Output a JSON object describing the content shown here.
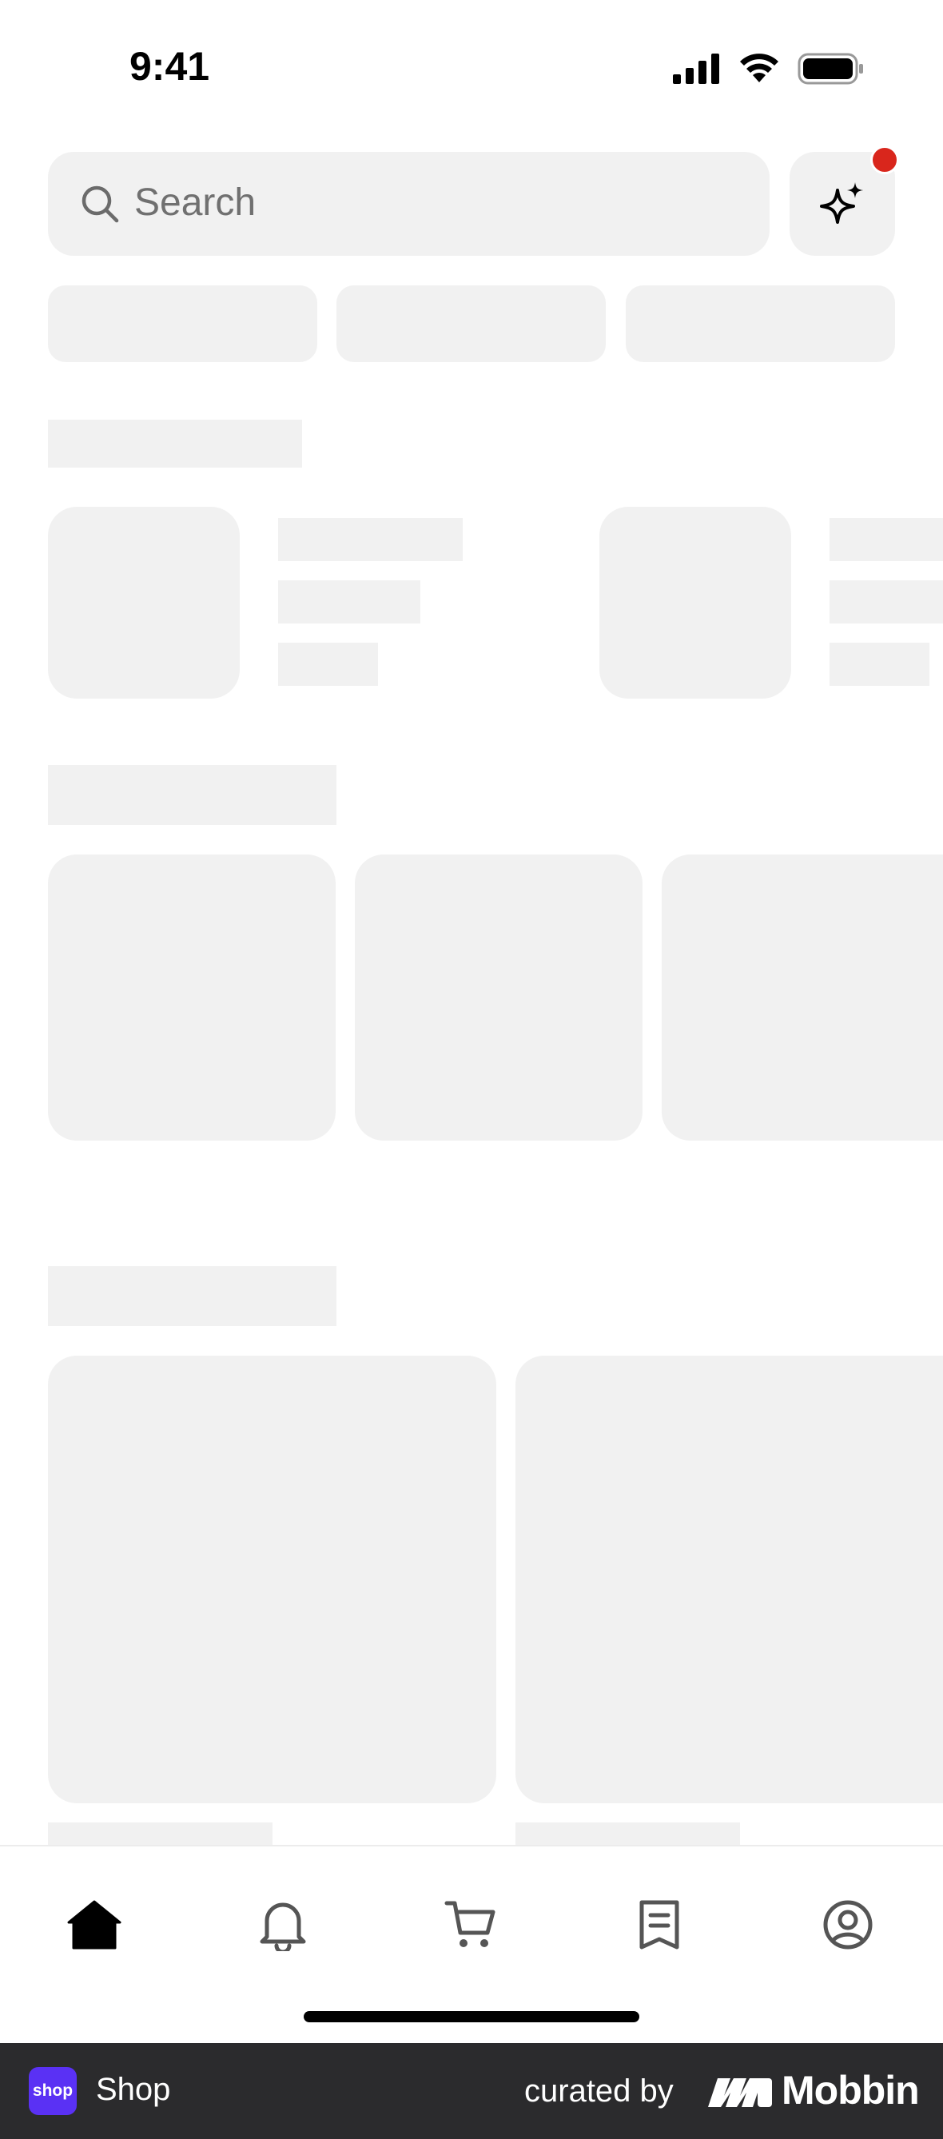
{
  "status_bar": {
    "time": "9:41"
  },
  "search": {
    "placeholder": "Search"
  },
  "tab_bar": {
    "tabs": [
      {
        "icon": "home-icon",
        "active": true
      },
      {
        "icon": "bell-icon",
        "active": false
      },
      {
        "icon": "cart-icon",
        "active": false
      },
      {
        "icon": "receipt-icon",
        "active": false
      },
      {
        "icon": "account-icon",
        "active": false
      }
    ]
  },
  "footer": {
    "app_logo_text": "shop",
    "app_name": "Shop",
    "curated_by": "curated by",
    "brand": "Mobbin"
  },
  "colors": {
    "skeleton": "#f1f1f1",
    "notification_dot": "#d9261c",
    "footer_bg": "#2b2b2d",
    "shop_purple": "#5a31f4"
  }
}
